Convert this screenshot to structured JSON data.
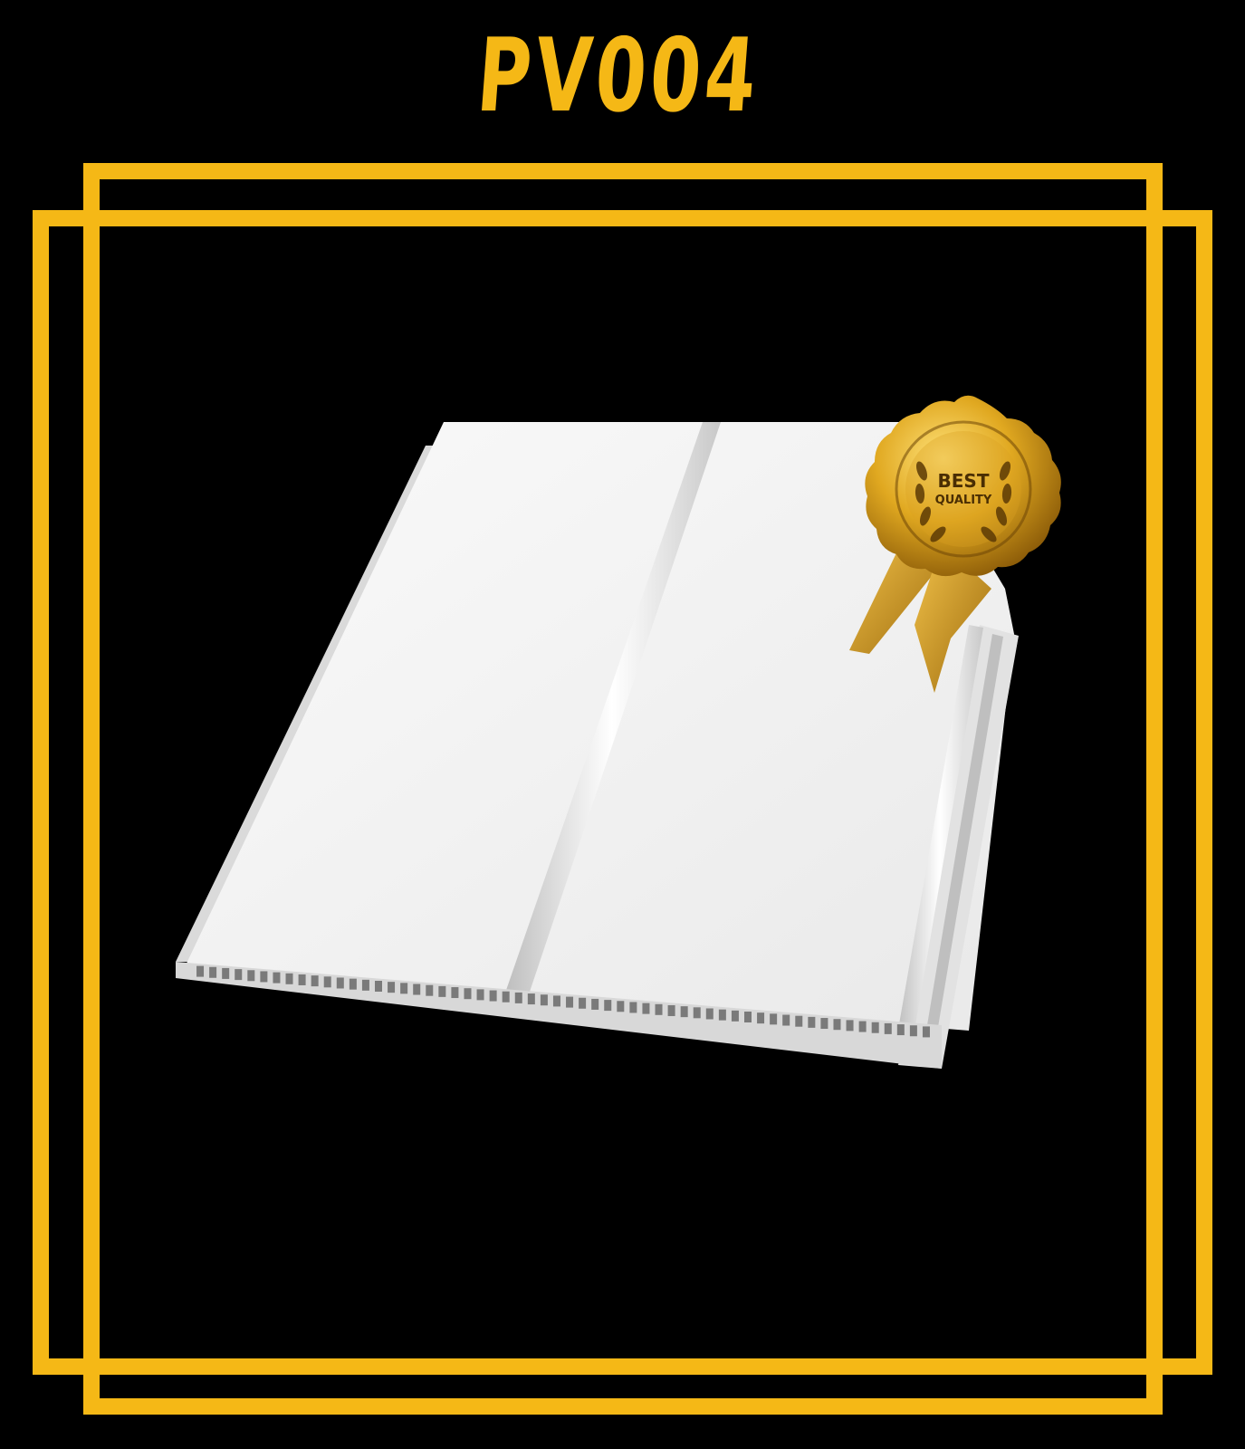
{
  "header": {
    "product_code": "PV004"
  },
  "badge": {
    "line1": "BEST",
    "line2": "QUALITY"
  },
  "colors": {
    "background": "#000000",
    "accent_gold": "#F5B816",
    "panel_white": "#F2F2F2"
  }
}
